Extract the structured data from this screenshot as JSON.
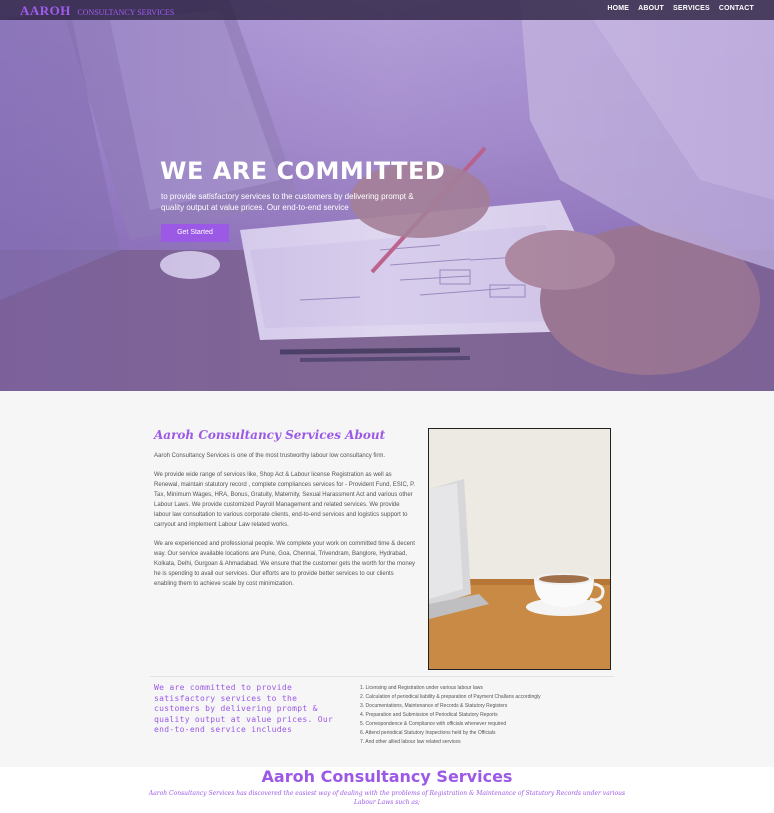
{
  "header": {
    "logo_main": "AAROH",
    "logo_sub": "CONSULTANCY SERVICES",
    "nav": [
      "HOME",
      "ABOUT",
      "SERVICES",
      "CONTACT"
    ]
  },
  "hero": {
    "title": "WE ARE COMMITTED",
    "text": "to provide satisfactory services to the customers by delivering prompt & quality output at value prices. Our end-to-end service",
    "cta_label": "Get Started"
  },
  "about": {
    "title": "Aaroh Consultancy Services About",
    "paragraphs": [
      "Aaroh Consultancy Services is one of the most trustworthy labour low consultancy firm.",
      "We provide wide range of services like, Shop Act & Labour license Registration as well as Renewal, maintain statutory record , complete compliances services for - Provident Fund, ESIC, P. Tax, Minimum Wages, HRA, Bonus, Gratuity, Maternity, Sexual Harassment Act and various other Labour Laws. We provide customized Payroll Management and related services. We provide labour law consultation to various corporate clients, end-to-end services and logistics support to carryout and implement Labour Law related works.",
      "We are experienced and professional people. We complete your work on committed time & decent way. Our service available locations are Pune, Goa, Chennai, Trivendram, Banglore, Hydrabad, Kolkata, Delhi, Gurgoan & Ahmadabad. We ensure that the customer gets the worth for the money he is spending to avail our services. Our efforts are to provide better services to our clients enabling them to achieve scale by cost minimization."
    ],
    "commitment": "We are committed to provide satisfactory services to the customers by delivering prompt & quality output at value prices. Our end-to-end service includes",
    "services": [
      "1. Licensing and Registration under various labour laws",
      "2. Calculation of periodical liability & preparation of Payment Challans accordingly",
      "3. Documentations, Maintenance of Records & Statutory Registers",
      "4. Preparation and Submission of Periodical Statutory Reports",
      "5. Correspondence & Compliance with officials whenever required",
      "6. Attend periodical Statutory Inspections held by the Officials",
      "7. And other allied labour law related services"
    ]
  },
  "bottom": {
    "title": "Aaroh Consultancy Services",
    "text": "Aaroh Consultancy Services has discovered the easiest way of dealing with the problems of Registration & Maintenance of Statutory Records under various Labour Laws such as;"
  },
  "colors": {
    "accent": "#9b59e6",
    "topbar": "#281e3c"
  }
}
